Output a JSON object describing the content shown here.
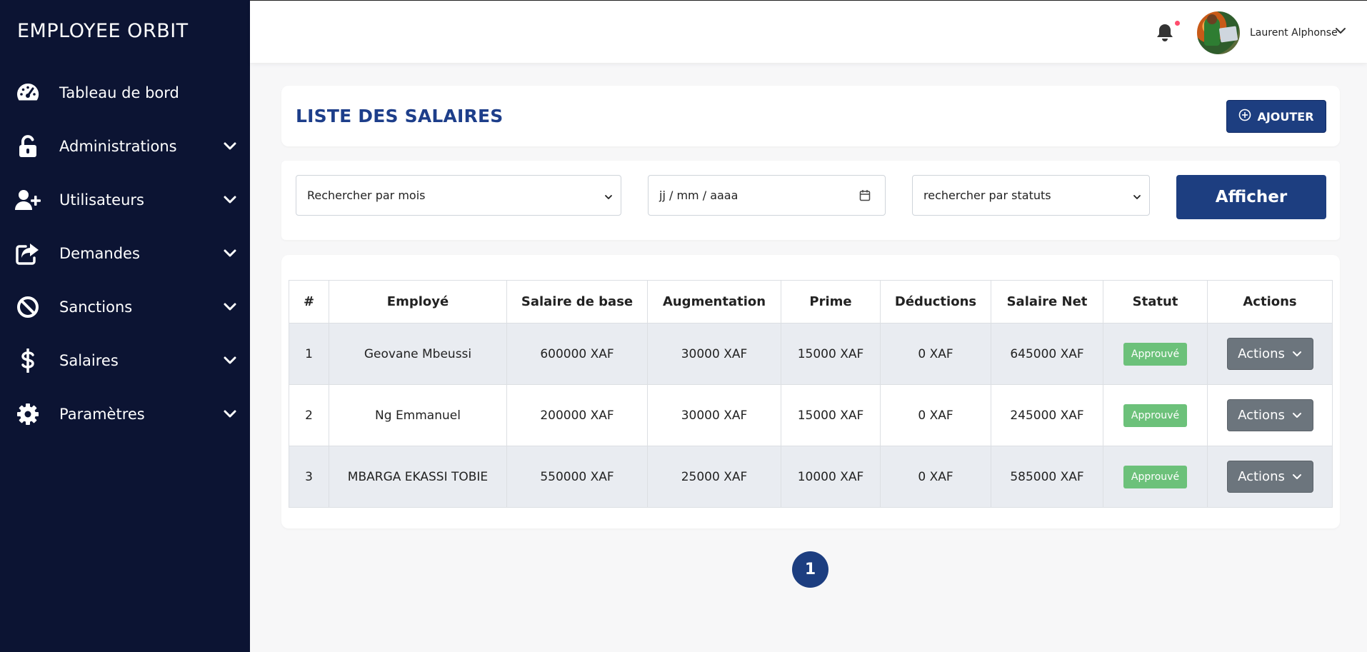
{
  "app": {
    "logo_text": "EMPLOYEE ORBIT"
  },
  "sidebar": {
    "items": [
      {
        "label": "Tableau de bord",
        "icon": "dashboard-gauge-icon",
        "has_chevron": false
      },
      {
        "label": "Administrations",
        "icon": "unlock-icon",
        "has_chevron": true
      },
      {
        "label": "Utilisateurs",
        "icon": "user-plus-icon",
        "has_chevron": true
      },
      {
        "label": "Demandes",
        "icon": "share-out-icon",
        "has_chevron": true
      },
      {
        "label": "Sanctions",
        "icon": "ban-icon",
        "has_chevron": true
      },
      {
        "label": "Salaires",
        "icon": "dollar-icon",
        "has_chevron": true
      },
      {
        "label": "Paramètres",
        "icon": "gear-icon",
        "has_chevron": true
      }
    ]
  },
  "header": {
    "user_name": "Laurent Alphonse",
    "notification_icon": "bell-icon"
  },
  "page": {
    "title": "LISTE DES SALAIRES",
    "add_button": "AJOUTER"
  },
  "filters": {
    "month_select": "Rechercher par mois",
    "date_placeholder": "jj / mm / aaaa",
    "status_select": "rechercher par statuts",
    "submit_label": "Afficher"
  },
  "table": {
    "headers": [
      "#",
      "Employé",
      "Salaire de base",
      "Augmentation",
      "Prime",
      "Déductions",
      "Salaire Net",
      "Statut",
      "Actions"
    ],
    "rows": [
      {
        "num": "1",
        "employee": "Geovane Mbeussi",
        "base": "600000 XAF",
        "raise": "30000 XAF",
        "bonus": "15000 XAF",
        "deductions": "0 XAF",
        "net": "645000 XAF",
        "status": "Approuvé",
        "action": "Actions"
      },
      {
        "num": "2",
        "employee": "Ng Emmanuel",
        "base": "200000 XAF",
        "raise": "30000 XAF",
        "bonus": "15000 XAF",
        "deductions": "0 XAF",
        "net": "245000 XAF",
        "status": "Approuvé",
        "action": "Actions"
      },
      {
        "num": "3",
        "employee": "MBARGA EKASSI TOBIE",
        "base": "550000 XAF",
        "raise": "25000 XAF",
        "bonus": "10000 XAF",
        "deductions": "0 XAF",
        "net": "585000 XAF",
        "status": "Approuvé",
        "action": "Actions"
      }
    ]
  },
  "pagination": {
    "current": "1"
  },
  "colors": {
    "sidebar_bg": "#0c1433",
    "primary": "#1d3e80",
    "title": "#1d3e8a",
    "status_approved": "#6cc17a",
    "actions_btn": "#6c757d"
  }
}
